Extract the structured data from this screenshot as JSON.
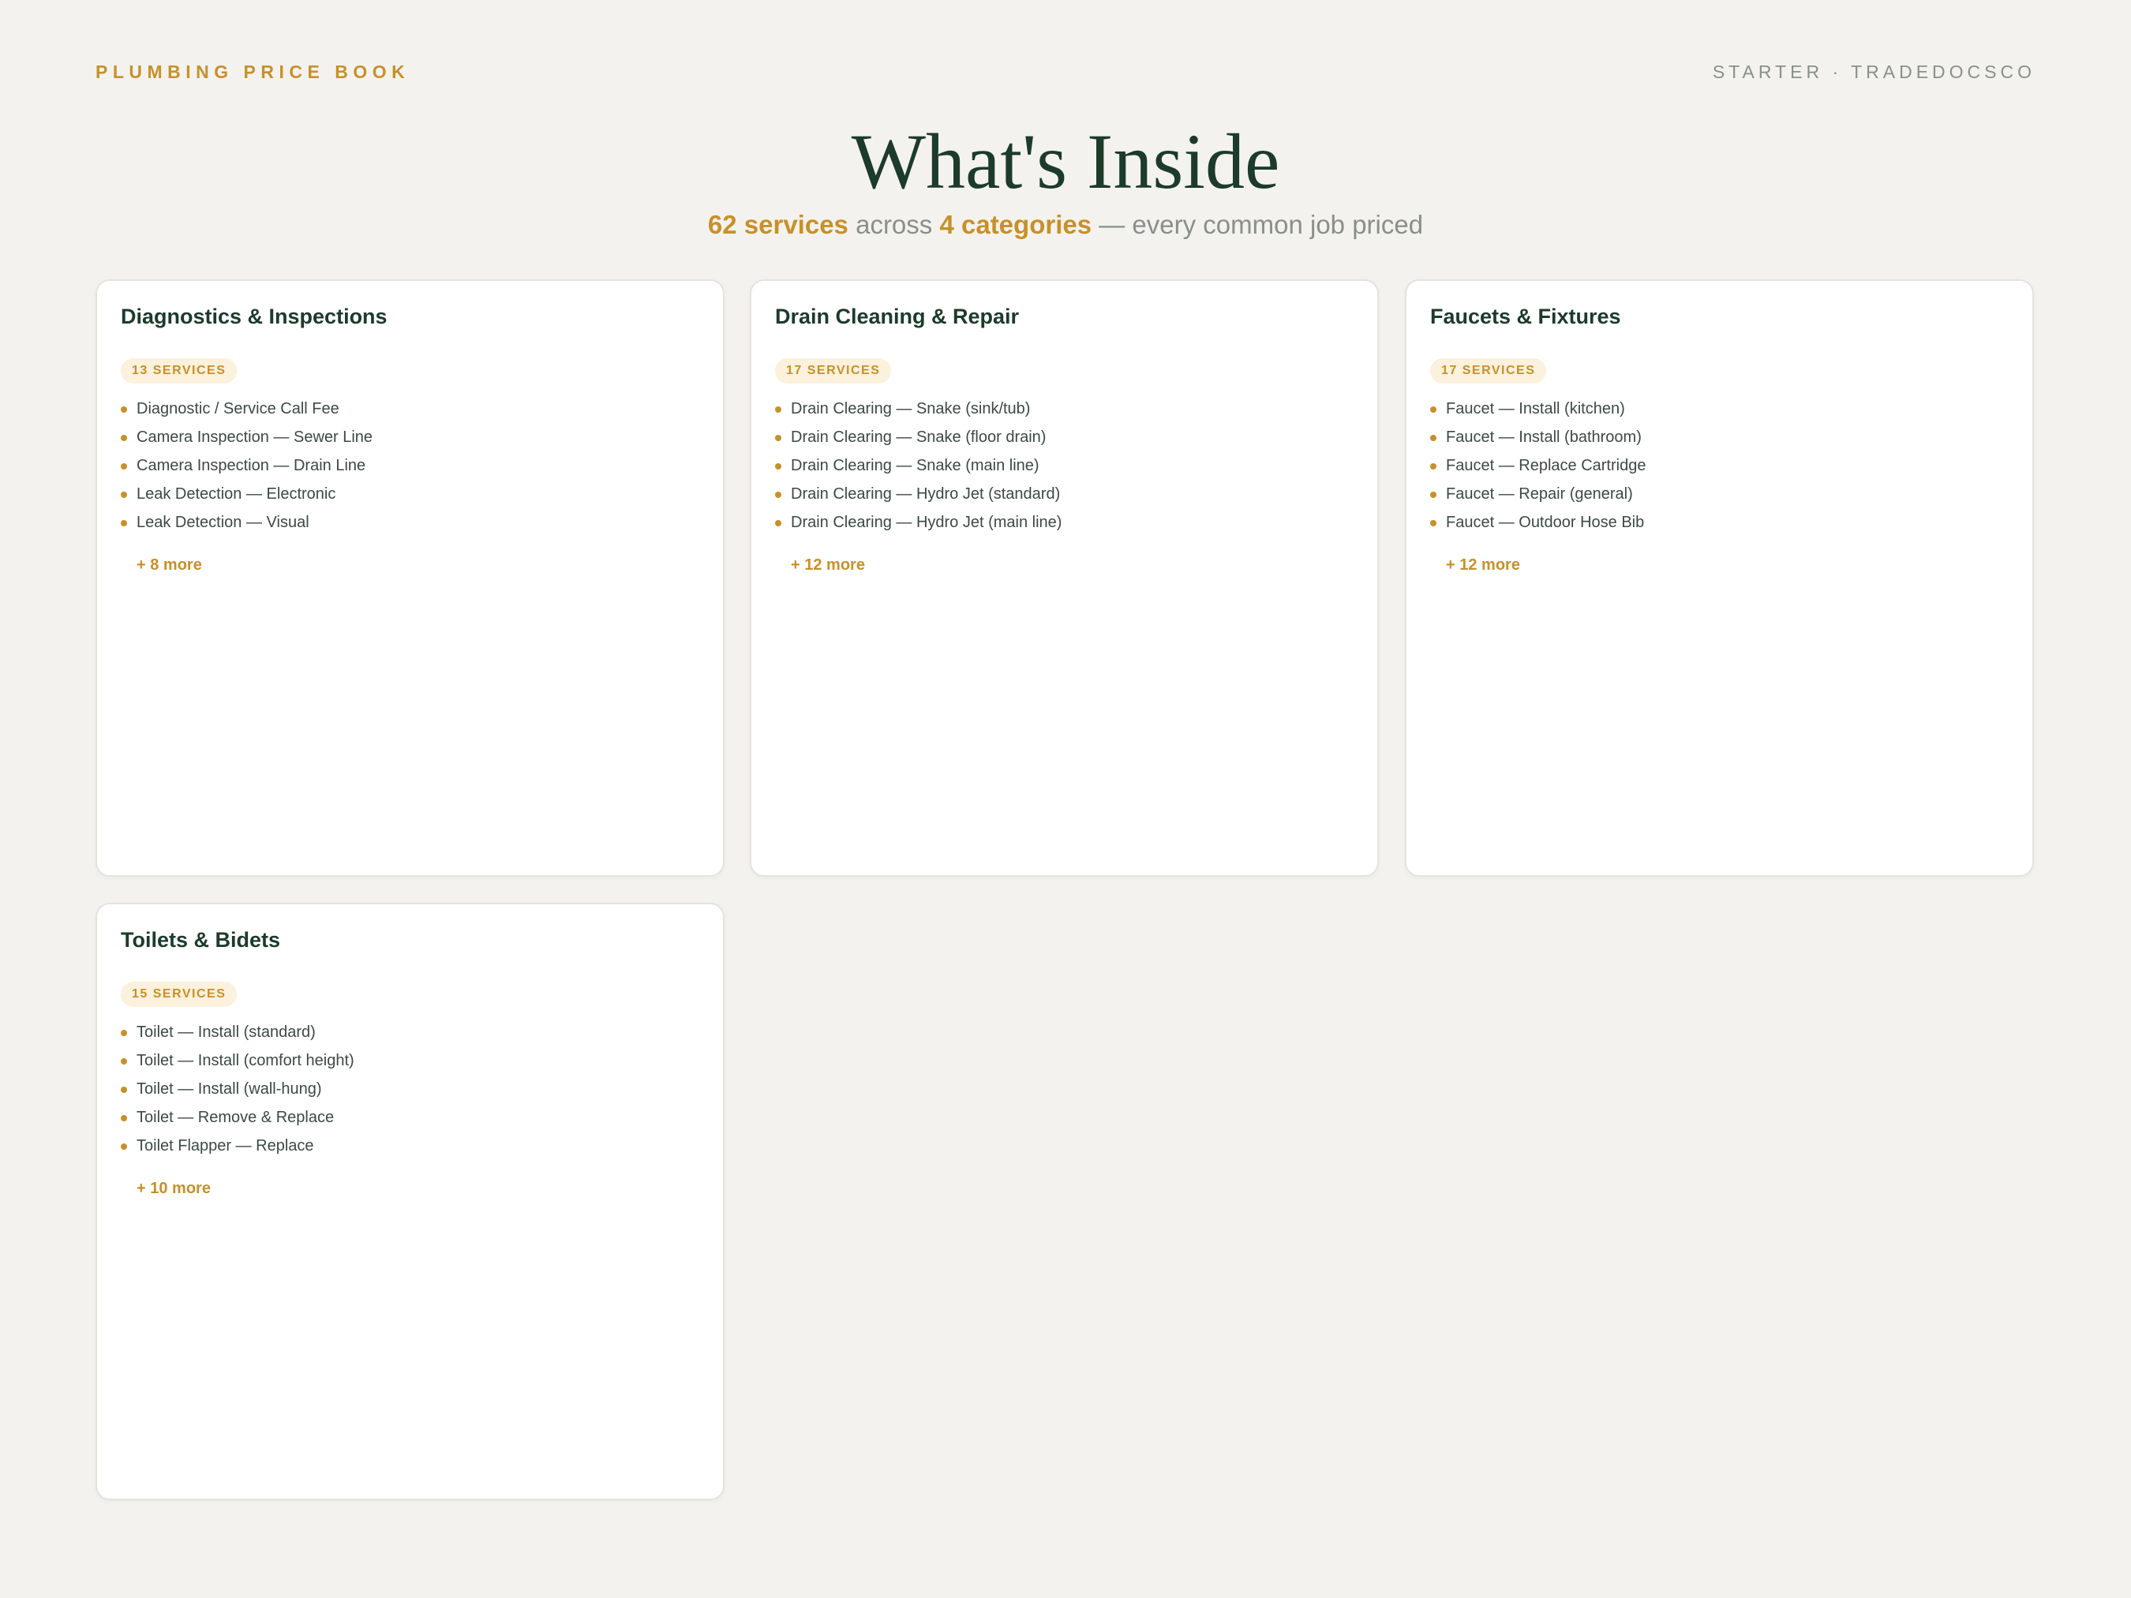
{
  "header": {
    "brand": "PLUMBING PRICE BOOK",
    "edition": "STARTER · TRADEDOCSCO"
  },
  "title": "What's Inside",
  "subtitle": {
    "services": "62 services",
    "across": "across",
    "categories": "4 categories",
    "tail": "— every common job priced"
  },
  "cards": [
    {
      "title": "Diagnostics & Inspections",
      "badge": "13 SERVICES",
      "items": [
        "Diagnostic / Service Call Fee",
        "Camera Inspection — Sewer Line",
        "Camera Inspection — Drain Line",
        "Leak Detection — Electronic",
        "Leak Detection — Visual"
      ],
      "more": "+ 8 more"
    },
    {
      "title": "Drain Cleaning & Repair",
      "badge": "17 SERVICES",
      "items": [
        "Drain Clearing — Snake (sink/tub)",
        "Drain Clearing — Snake (floor drain)",
        "Drain Clearing — Snake (main line)",
        "Drain Clearing — Hydro Jet (standard)",
        "Drain Clearing — Hydro Jet (main line)"
      ],
      "more": "+ 12 more"
    },
    {
      "title": "Faucets & Fixtures",
      "badge": "17 SERVICES",
      "items": [
        "Faucet — Install (kitchen)",
        "Faucet — Install (bathroom)",
        "Faucet — Replace Cartridge",
        "Faucet — Repair (general)",
        "Faucet — Outdoor Hose Bib"
      ],
      "more": "+ 12 more"
    },
    {
      "title": "Toilets & Bidets",
      "badge": "15 SERVICES",
      "items": [
        "Toilet — Install (standard)",
        "Toilet — Install (comfort height)",
        "Toilet — Install (wall-hung)",
        "Toilet — Remove & Replace",
        "Toilet Flapper — Replace"
      ],
      "more": "+ 10 more"
    }
  ],
  "colors": {
    "accent": "#c8902a",
    "heading": "#1c3b2a",
    "muted": "#8a8f8a",
    "background": "#f3f2ee"
  }
}
